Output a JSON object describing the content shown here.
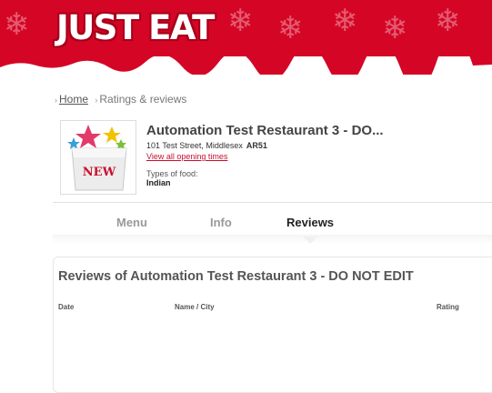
{
  "header": {
    "logo_text": "JUST EAT",
    "brand_color": "#d50525"
  },
  "breadcrumb": {
    "home": "Home",
    "current": "Ratings & reviews"
  },
  "restaurant": {
    "name": "Automation Test Restaurant 3 - DO...",
    "address": "101 Test Street, Middlesex",
    "postcode": "AR51",
    "opening_times_link": "View all opening times",
    "food_types_label": "Types of food:",
    "food_types": "Indian",
    "image_badge": "NEW"
  },
  "tabs": [
    {
      "label": "Menu"
    },
    {
      "label": "Info"
    },
    {
      "label": "Reviews"
    }
  ],
  "reviews": {
    "title": "Reviews of Automation Test Restaurant 3 - DO NOT EDIT",
    "columns": {
      "date": "Date",
      "name_city": "Name / City",
      "rating": "Rating"
    }
  }
}
